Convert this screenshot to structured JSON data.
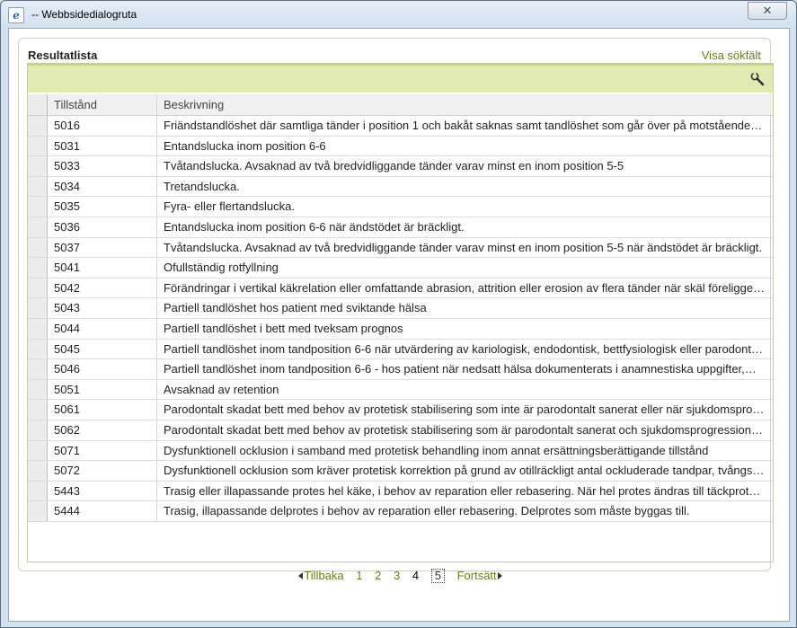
{
  "window": {
    "title": "-- Webbsidedialogruta",
    "app_icon": "ie-icon",
    "close_glyph": "✕"
  },
  "panel": {
    "title": "Resultatlista",
    "link": "Visa sökfält",
    "toolbar_icon": "wrench-icon"
  },
  "table": {
    "columns": [
      "Tillstånd",
      "Beskrivning"
    ],
    "rows": [
      [
        "5016",
        "Friändstandlöshet där samtliga tänder i position 1 och bakåt saknas samt tandlöshet som går över på motstående…"
      ],
      [
        "5031",
        "Entandslucka inom position 6-6"
      ],
      [
        "5033",
        "Tvåtandslucka. Avsaknad av två bredvidliggande tänder varav minst en inom position 5-5"
      ],
      [
        "5034",
        "Tretandslucka."
      ],
      [
        "5035",
        "Fyra- eller flertandslucka."
      ],
      [
        "5036",
        "Entandslucka inom position 6-6 när ändstödet är bräckligt."
      ],
      [
        "5037",
        "Tvåtandslucka. Avsaknad av två bredvidliggande tänder varav minst en inom position 5-5 när ändstödet är bräckligt."
      ],
      [
        "5041",
        "Ofullständig rotfyllning"
      ],
      [
        "5042",
        "Förändringar i vertikal käkrelation eller omfattande abrasion, attrition eller erosion av flera tänder när skäl föreligger…"
      ],
      [
        "5043",
        "Partiell tandlöshet hos patient med sviktande hälsa"
      ],
      [
        "5044",
        "Partiell tandlöshet i bett med tveksam prognos"
      ],
      [
        "5045",
        "Partiell tandlöshet inom tandposition 6-6 när utvärdering av kariologisk, endodontisk, bettfysiologisk eller parodont…"
      ],
      [
        "5046",
        "Partiell tandlöshet inom tandposition 6-6 - hos patient när nedsatt hälsa dokumenterats i anamnestiska uppgifter,…"
      ],
      [
        "5051",
        "Avsaknad av retention"
      ],
      [
        "5061",
        "Parodontalt skadat bett med behov av protetisk stabilisering som inte är parodontalt sanerat eller när sjukdomspro…"
      ],
      [
        "5062",
        "Parodontalt skadat bett med behov av protetisk stabilisering som är parodontalt sanerat och sjukdomsprogression…"
      ],
      [
        "5071",
        "Dysfunktionell ocklusion i samband med protetisk behandling inom annat ersättningsberättigande tillstånd"
      ],
      [
        "5072",
        "Dysfunktionell ocklusion som kräver protetisk korrektion på grund av otillräckligt antal ockluderade tandpar, tvångs…"
      ],
      [
        "5443",
        "Trasig eller illapassande protes hel käke, i behov av reparation eller rebasering. När hel protes ändras till täckprote…"
      ],
      [
        "5444",
        "Trasig, illapassande delprotes i behov av reparation eller rebasering. Delprotes som måste byggas till."
      ]
    ]
  },
  "pager": {
    "prev_label": "Tillbaka",
    "pages": [
      "1",
      "2",
      "3",
      "4",
      "5"
    ],
    "current_page": "4",
    "focused_page": "5",
    "next_label": "Fortsätt"
  },
  "colors": {
    "toolbar_bg": "#e1ebb1",
    "link": "#6c7a1e"
  }
}
